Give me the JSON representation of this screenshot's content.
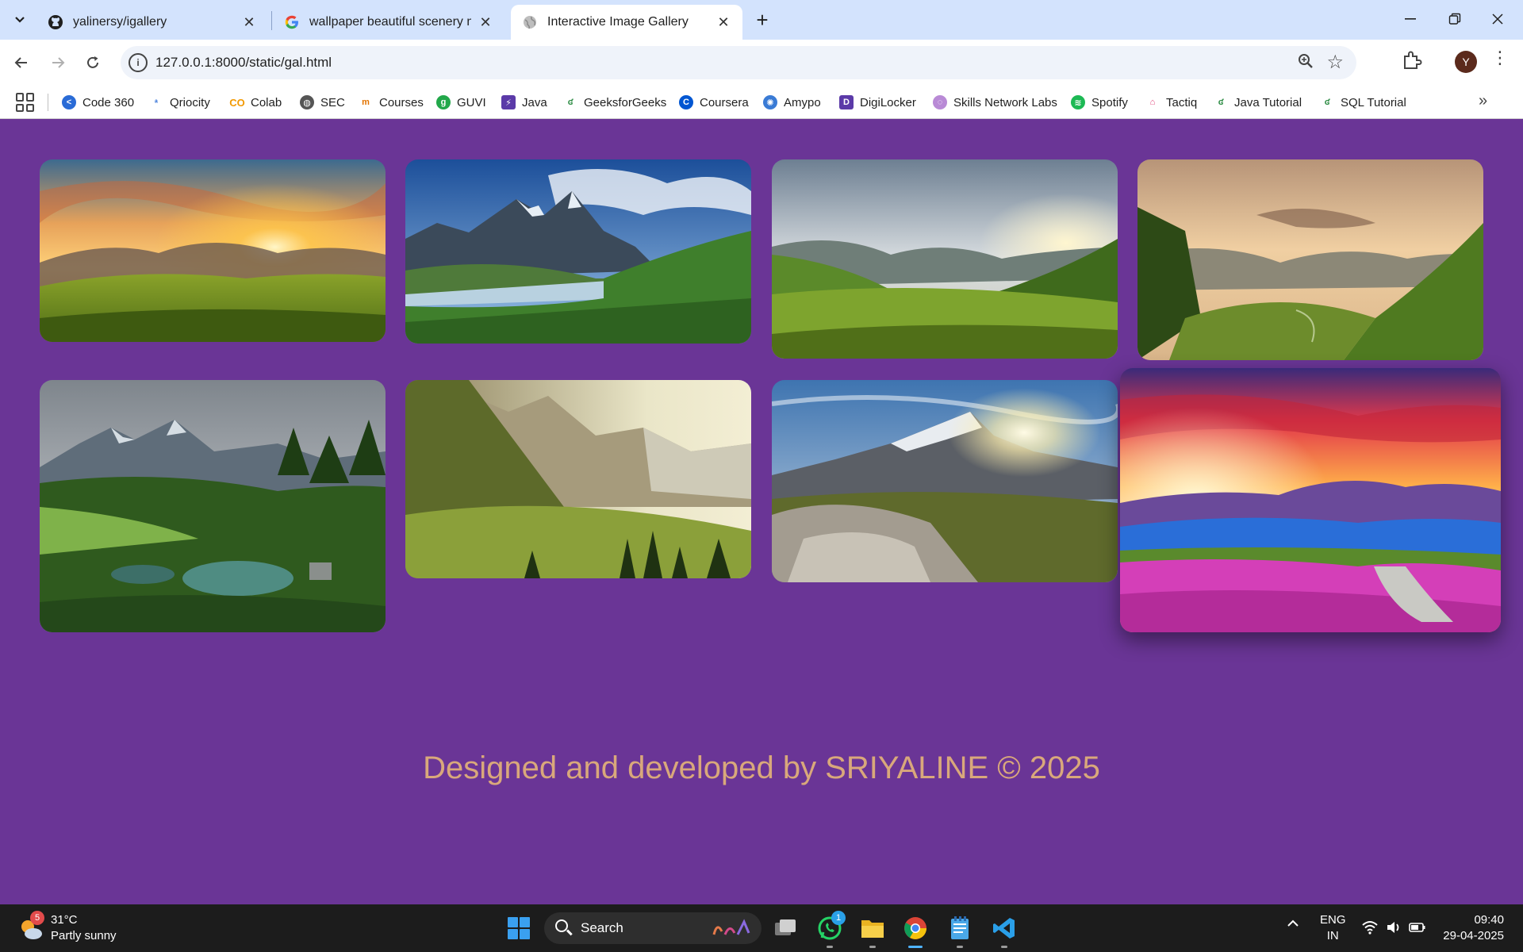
{
  "browser": {
    "tabs": [
      {
        "title": "yalinersy/igallery",
        "icon": "github-icon",
        "active": false
      },
      {
        "title": "wallpaper beautiful scenery mo",
        "icon": "google-icon",
        "active": false
      },
      {
        "title": "Interactive Image Gallery",
        "icon": "globe-icon",
        "active": true
      }
    ],
    "url": "127.0.0.1:8000/static/gal.html",
    "profile_initial": "Y",
    "bookmarks": [
      {
        "label": "Code 360",
        "color": "#2a6bd6"
      },
      {
        "label": "Qriocity",
        "color": "#ffffff"
      },
      {
        "label": "Colab",
        "color": "#f29900"
      },
      {
        "label": "SEC",
        "color": "#555555"
      },
      {
        "label": "Courses",
        "color": "#e37400"
      },
      {
        "label": "GUVI",
        "color": "#22a84a"
      },
      {
        "label": "Java",
        "color": "#5b3aa8"
      },
      {
        "label": "GeeksforGeeks",
        "color": "#2f8d46"
      },
      {
        "label": "Coursera",
        "color": "#0056d2"
      },
      {
        "label": "Amypo",
        "color": "#3a7bd5"
      },
      {
        "label": "DigiLocker",
        "color": "#5b3aa8"
      },
      {
        "label": "Skills Network Labs",
        "color": "#b98ad6"
      },
      {
        "label": "Spotify",
        "color": "#1db954"
      },
      {
        "label": "Tactiq",
        "color": "#e0447a"
      },
      {
        "label": "Java Tutorial",
        "color": "#2f8d46"
      },
      {
        "label": "SQL Tutorial",
        "color": "#2f8d46"
      }
    ]
  },
  "gallery": {
    "images": [
      {
        "name": "sunset-meadow"
      },
      {
        "name": "mountain-lake"
      },
      {
        "name": "green-valley-sunrise"
      },
      {
        "name": "golden-valley"
      },
      {
        "name": "forest-pond"
      },
      {
        "name": "alpine-valley-haze"
      },
      {
        "name": "rocky-peak-sunburst"
      },
      {
        "name": "flower-field-sunset"
      }
    ],
    "credit": "Designed and developed by SRIYALINE © 2025"
  },
  "taskbar": {
    "weather_temp": "31°C",
    "weather_desc": "Partly sunny",
    "weather_badge": "5",
    "search_label": "Search",
    "whatsapp_badge": "1",
    "lang_line1": "ENG",
    "lang_line2": "IN",
    "time": "09:40",
    "date": "29-04-2025"
  },
  "colors": {
    "page_bg": "#6a3596",
    "credit_text": "#d9a87b",
    "tabstrip": "#d3e3fd"
  }
}
